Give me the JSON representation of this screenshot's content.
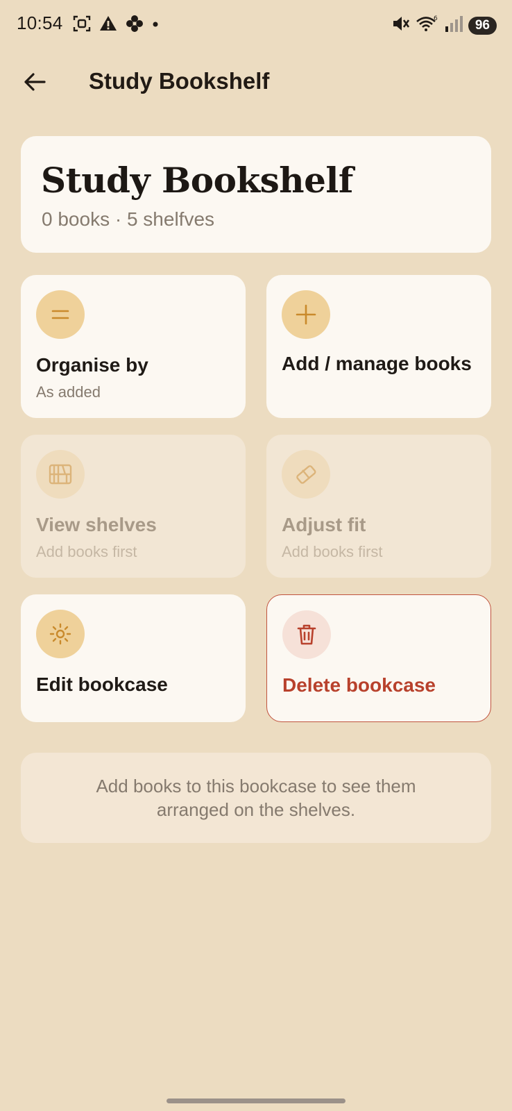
{
  "status_bar": {
    "time": "10:54",
    "left_icons": [
      "screenshot-icon",
      "warning-icon",
      "flower-icon",
      "dot-icon"
    ],
    "right_icons": [
      "mute-icon",
      "wifi-icon",
      "signal-icon"
    ],
    "battery": "96"
  },
  "app_bar": {
    "title": "Study Bookshelf",
    "back_icon": "arrow-left-icon"
  },
  "header": {
    "title": "Study Bookshelf",
    "subtitle": "0 books · 5 shelfves"
  },
  "tiles": {
    "organise": {
      "label": "Organise by",
      "sub": "As added",
      "icon": "equals-icon",
      "enabled": true
    },
    "add": {
      "label": "Add / manage books",
      "icon": "plus-icon",
      "enabled": true
    },
    "view": {
      "label": "View shelves",
      "sub": "Add books first",
      "icon": "shelf-icon",
      "enabled": false
    },
    "adjust": {
      "label": "Adjust fit",
      "sub": "Add books first",
      "icon": "eraser-icon",
      "enabled": false
    },
    "edit": {
      "label": "Edit bookcase",
      "icon": "gear-icon",
      "enabled": true
    },
    "delete": {
      "label": "Delete bookcase",
      "icon": "trash-icon",
      "enabled": true
    }
  },
  "info": {
    "text": "Add books to this bookcase to see them arranged on the shelves."
  },
  "colors": {
    "background": "#ecdcc1",
    "card": "#fcf8f2",
    "disabled_card": "#f2e6d4",
    "icon_circle": "#efd19a",
    "icon_stroke": "#c98a2c",
    "danger": "#b8412c"
  }
}
